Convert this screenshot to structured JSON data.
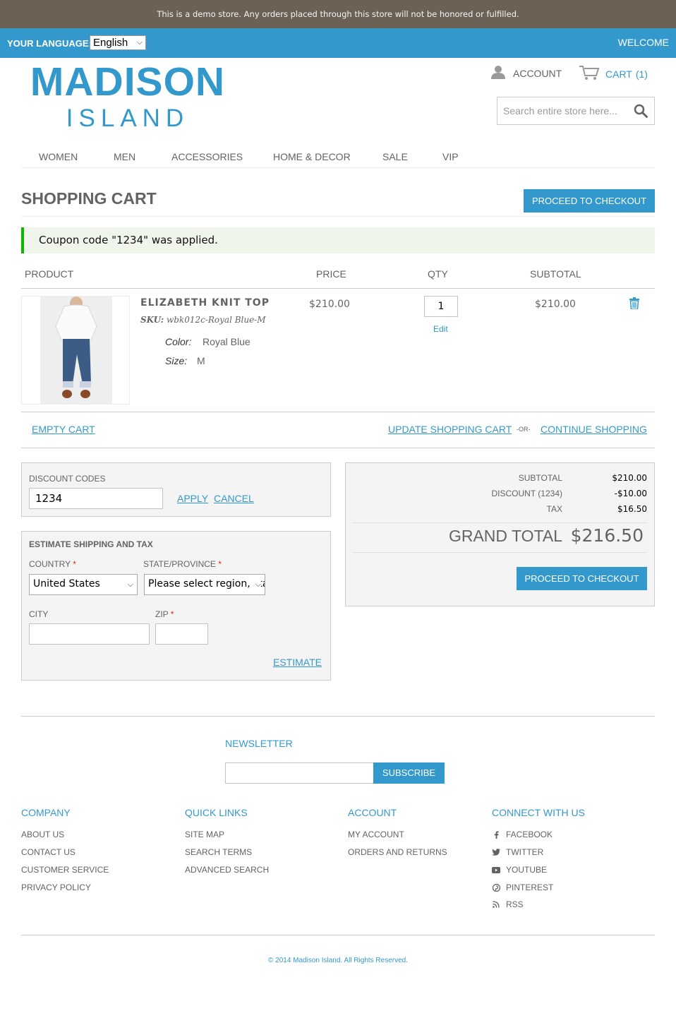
{
  "demo_notice": "This is a demo store. Any orders placed through this store will not be honored or fulfilled.",
  "header": {
    "language_label": "YOUR LANGUAGE:",
    "language_value": "English",
    "welcome": "WELCOME",
    "logo_main": "MADISON",
    "logo_sub": "ISLAND",
    "account_label": "ACCOUNT",
    "cart_label": "CART",
    "cart_count": "(1)",
    "search_placeholder": "Search entire store here..."
  },
  "nav": [
    "WOMEN",
    "MEN",
    "ACCESSORIES",
    "HOME & DECOR",
    "SALE",
    "VIP"
  ],
  "page": {
    "title": "SHOPPING CART",
    "checkout_label": "PROCEED TO CHECKOUT",
    "success_message": "Coupon code \"1234\" was applied."
  },
  "cart_table": {
    "headers": {
      "product": "PRODUCT",
      "price": "PRICE",
      "qty": "QTY",
      "subtotal": "SUBTOTAL"
    },
    "item": {
      "name": "ELIZABETH KNIT TOP",
      "sku_label": "SKU:",
      "sku": "wbk012c-Royal Blue-M",
      "color_label": "Color:",
      "color_value": "Royal Blue",
      "size_label": "Size:",
      "size_value": "M",
      "price": "$210.00",
      "qty": "1",
      "edit_label": "Edit",
      "subtotal": "$210.00"
    },
    "empty_cart": "EMPTY CART",
    "update_cart": "UPDATE SHOPPING CART",
    "or": "-OR-",
    "continue_shopping": "CONTINUE SHOPPING"
  },
  "discount": {
    "label": "DISCOUNT CODES",
    "code": "1234",
    "apply": "APPLY",
    "cancel": "CANCEL"
  },
  "shipping": {
    "heading": "ESTIMATE SHIPPING AND TAX",
    "country_label": "COUNTRY",
    "country_value": "United States",
    "state_label": "STATE/PROVINCE",
    "state_value": "Please select region, state or province",
    "city_label": "CITY",
    "city_value": "",
    "zip_label": "ZIP",
    "zip_value": "",
    "required_mark": "*",
    "estimate": "ESTIMATE"
  },
  "totals": {
    "subtotal_label": "SUBTOTAL",
    "subtotal_value": "$210.00",
    "discount_label": "DISCOUNT (1234)",
    "discount_value": "-$10.00",
    "tax_label": "TAX",
    "tax_value": "$16.50",
    "grand_label": "GRAND TOTAL",
    "grand_value": "$216.50",
    "checkout_label": "PROCEED TO CHECKOUT"
  },
  "footer": {
    "newsletter_title": "NEWSLETTER",
    "subscribe": "SUBSCRIBE",
    "company": {
      "title": "COMPANY",
      "links": [
        "ABOUT US",
        "CONTACT US",
        "CUSTOMER SERVICE",
        "PRIVACY POLICY"
      ]
    },
    "quick_links": {
      "title": "QUICK LINKS",
      "links": [
        "SITE MAP",
        "SEARCH TERMS",
        "ADVANCED SEARCH"
      ]
    },
    "account": {
      "title": "ACCOUNT",
      "links": [
        "MY ACCOUNT",
        "ORDERS AND RETURNS"
      ]
    },
    "connect": {
      "title": "CONNECT WITH US",
      "links": [
        "FACEBOOK",
        "TWITTER",
        "YOUTUBE",
        "PINTEREST",
        "RSS"
      ]
    },
    "copyright": "© 2014 Madison Island. All Rights Reserved."
  },
  "colors": {
    "brand": "#3399cc",
    "demo_bar": "#6b6255",
    "success_accent": "#11b400",
    "required": "#df280a"
  }
}
